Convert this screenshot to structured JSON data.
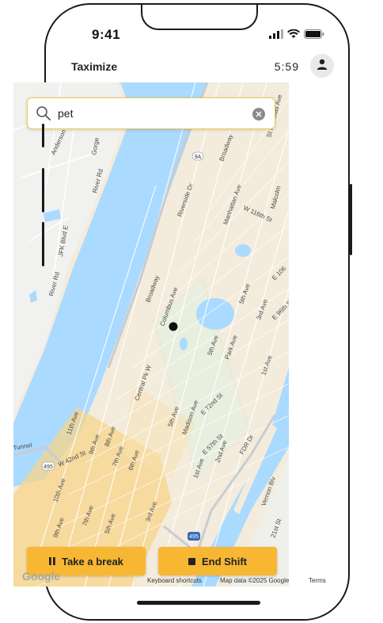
{
  "status_bar": {
    "time": "9:41"
  },
  "header": {
    "app_title": "Taximize",
    "timer": "5:59"
  },
  "search": {
    "value": "pet"
  },
  "map": {
    "attribution": {
      "google": "Google",
      "keyboard": "Keyboard shortcuts",
      "map_data": "Map data ©2025 Google",
      "terms": "Terms"
    },
    "labels": {
      "anderson": "Anderson",
      "gorge": "Gorge",
      "river_rd_1": "River Rd",
      "jfk": "JFK Blvd E",
      "river_rd_2": "River Rd",
      "broadway_1": "Broadway",
      "riverside": "Riverside Dr",
      "manhattan": "Manhattan Ave",
      "w116": "W 116th St",
      "malcolm": "Malcolm",
      "st_nicholas": "St Nicholas Ave",
      "broadway_2": "Broadway",
      "columbus": "Columbus Ave",
      "fifth_ave_1": "5th Ave",
      "third_ave": "3rd Ave",
      "e96": "E 96th St",
      "e106": "E 106",
      "fifth_ave_2": "5th Ave",
      "park_ave": "Park Ave",
      "first_ave_1": "1st Ave",
      "central_park_w": "Central Pk W",
      "e72": "E 72nd St",
      "fifth_ave_3": "5th Ave",
      "madison": "Madison Ave",
      "e57": "E 57th St",
      "second_ave": "2nd Ave",
      "fdr": "FDR Dr",
      "first_ave_2": "1st Ave",
      "eleventh_ave": "11th Ave",
      "ninth_ave_1": "9th Ave",
      "eighth_ave": "8th Ave",
      "seventh_ave_1": "7th Ave",
      "sixth_ave": "6th Ave",
      "w42": "W 42nd St",
      "tenth_ave": "10th Ave",
      "tunnel": "Tunnel",
      "ninth_ave_2": "9th Ave",
      "seventh_ave_2": "7th Ave",
      "fifth_ave_4": "5th Ave",
      "third_ave_2": "3rd Ave",
      "vernon": "Vernon Blv",
      "twenty_first": "21st St",
      "rt495_1": "495",
      "rt495_2": "495",
      "rt9a": "9A"
    }
  },
  "actions": {
    "take_break": "Take a break",
    "end_shift": "End Shift"
  },
  "colors": {
    "accent": "#f7b733",
    "water": "#aadaff",
    "park": "#c8e6c9",
    "land": "#f3ecdc"
  }
}
